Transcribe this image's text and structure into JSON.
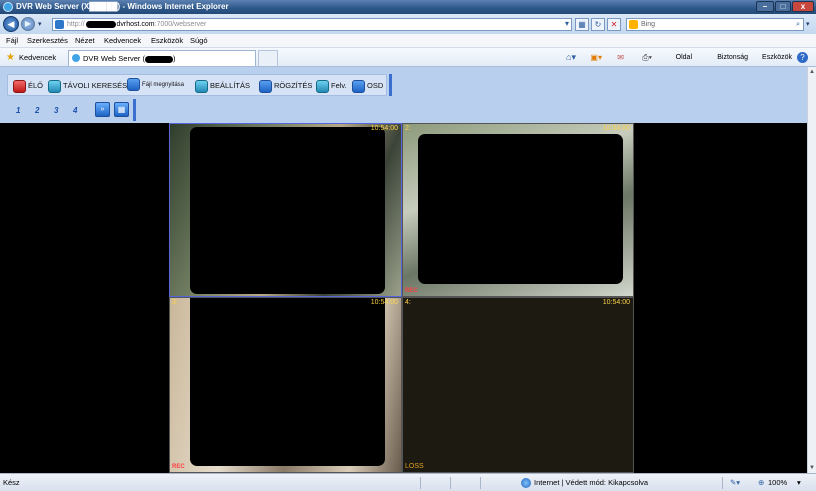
{
  "window": {
    "title": "DVR Web Server (X█████) - Windows Internet Explorer",
    "min": "–",
    "max": "□",
    "close": "x"
  },
  "address": {
    "prefix": "http://",
    "host": "dvrhost.com",
    "path": ":7000/webserver",
    "search_placeholder": "Bing"
  },
  "menu": [
    "Fájl",
    "Szerkesztés",
    "Nézet",
    "Kedvencek",
    "Eszközök",
    "Súgó"
  ],
  "favorites": {
    "label": "Kedvencek",
    "tab_title": "DVR Web Server ("
  },
  "commandbar": {
    "page": "Oldal ▾",
    "safety": "Biztonság ▾",
    "tools": "Eszközök ▾"
  },
  "toolbar": {
    "live": "ÉLŐ",
    "remote_search": "TÁVOLI KERESÉS",
    "file_open": "Fájl megnyitása",
    "settings": "BEÁLLÍTÁS",
    "record": "RÖGZÍTÉS",
    "upload": "Felv.",
    "osd": "OSD"
  },
  "channel_buttons": [
    "1",
    "2",
    "3",
    "4"
  ],
  "channels": [
    {
      "label": "",
      "time": "10:54:00",
      "footer": "REC"
    },
    {
      "label": "2:",
      "time": "10:54:00",
      "footer": "REC"
    },
    {
      "label": "3:",
      "time": "10:54:00",
      "footer": "REC"
    },
    {
      "label": "4:",
      "time": "10:54:00",
      "footer": "LOSS"
    }
  ],
  "status": {
    "ready": "Kész",
    "zone": "Internet | Védett mód: Kikapcsolva",
    "zoom": "100%"
  },
  "colors": {
    "toolbar_bg": "#b9cfee",
    "accent": "#3a6fd0",
    "osd_text": "#ffd54a",
    "rec_text": "#ff4040"
  }
}
